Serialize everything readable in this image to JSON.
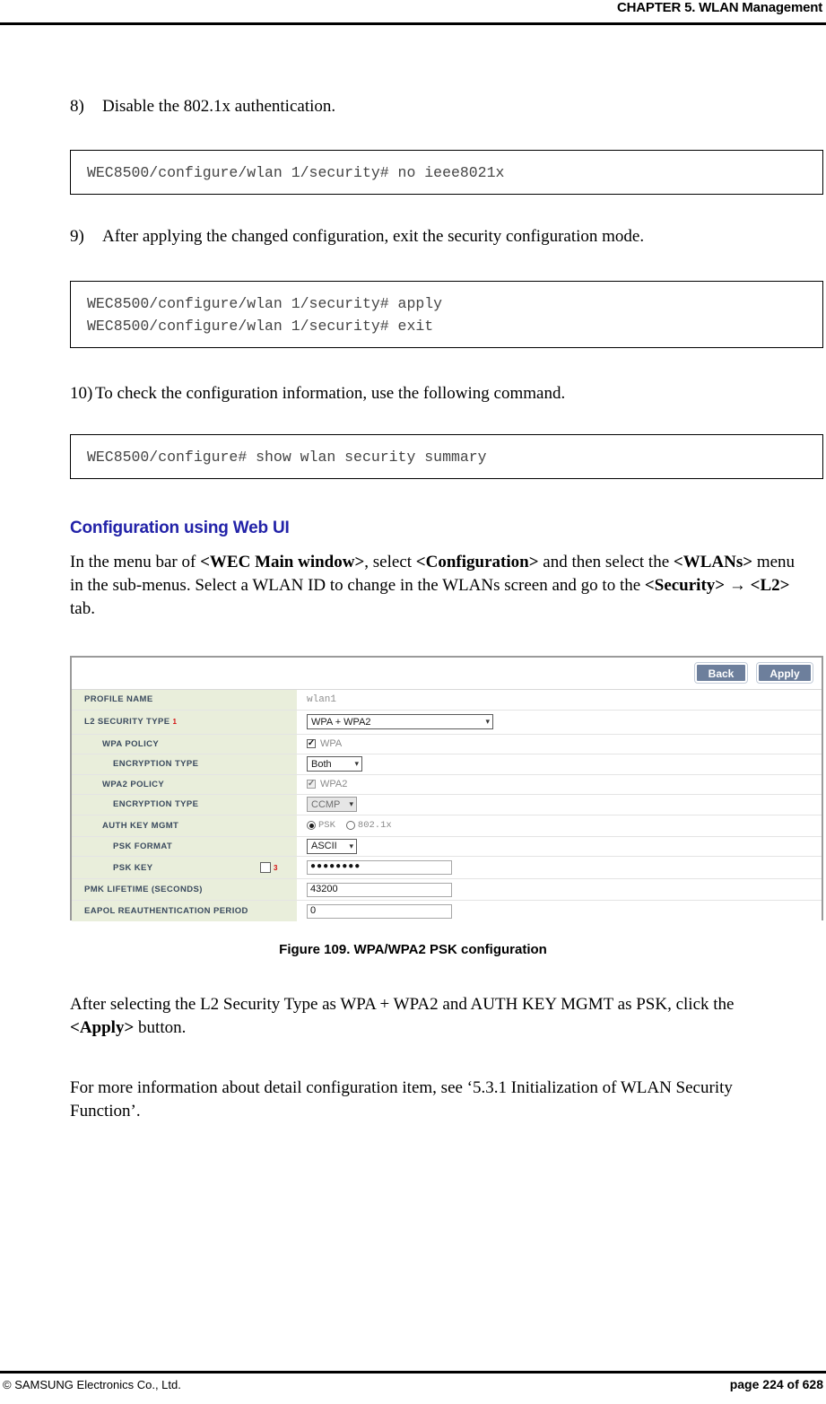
{
  "header": {
    "title": "CHAPTER 5. WLAN Management"
  },
  "footer": {
    "copyright": "© SAMSUNG Electronics Co., Ltd.",
    "page": "page 224 of 628"
  },
  "steps": {
    "step8": {
      "num": "8)",
      "text": "Disable the 802.1x authentication."
    },
    "step9": {
      "num": "9)",
      "text": "After applying the changed configuration, exit the security configuration mode."
    },
    "step10": {
      "num": "10)",
      "text": "To check the configuration information, use the following command."
    }
  },
  "code": {
    "block1_line1": "WEC8500/configure/wlan 1/security# no ieee8021x",
    "block2_line1": "WEC8500/configure/wlan 1/security# apply",
    "block2_line2": "WEC8500/configure/wlan 1/security# exit",
    "block3_line1": "WEC8500/configure# show wlan security summary"
  },
  "section": {
    "heading": "Configuration using Web UI",
    "intro_1": "In the menu bar of ",
    "intro_b1": "<WEC Main window>",
    "intro_2": ", select ",
    "intro_b2": "<Configuration>",
    "intro_3": " and then select the ",
    "intro_b3": "<WLANs>",
    "intro_4": " menu in the sub-menus. Select a WLAN ID to change in the WLANs screen and go to the ",
    "intro_b4": "<Security>",
    "intro_arrow": " → ",
    "intro_b5": "<L2>",
    "intro_5": " tab."
  },
  "figure": {
    "caption": "Figure 109. WPA/WPA2 PSK configuration",
    "toolbar": {
      "back_label": "Back",
      "apply_label": "Apply"
    },
    "rows": [
      {
        "label": "PROFILE NAME",
        "value": "wlan1"
      },
      {
        "label": "L2 SECURITY TYPE",
        "superscript": "1",
        "value": "WPA + WPA2"
      },
      {
        "label": "WPA POLICY",
        "checkbox_label": "WPA",
        "checked": true
      },
      {
        "label": "ENCRYPTION TYPE",
        "value": "Both"
      },
      {
        "label": "WPA2 POLICY",
        "checkbox_label": "WPA2",
        "checked": true
      },
      {
        "label": "ENCRYPTION TYPE",
        "value": "CCMP"
      },
      {
        "label": "AUTH KEY MGMT",
        "option1": "PSK",
        "option2": "802.1x",
        "selected": "PSK"
      },
      {
        "label": "PSK FORMAT",
        "value": "ASCII"
      },
      {
        "label": "PSK KEY",
        "superscript": "3",
        "value": "●●●●●●●●"
      },
      {
        "label": "PMK LIFETIME (SECONDS)",
        "value": "43200"
      },
      {
        "label": "EAPOL REAUTHENTICATION PERIOD",
        "value": "0"
      }
    ]
  },
  "closing": {
    "para1_a": "After selecting the L2 Security Type as WPA + WPA2 and AUTH KEY MGMT as PSK, click the ",
    "para1_b": "<Apply>",
    "para1_c": " button.",
    "para2": "For more information about detail configuration item, see ‘5.3.1 Initialization of WLAN Security Function’."
  },
  "colors": {
    "heading": "#2222a8",
    "label_bg": "#e9eedb",
    "button_bg": "#6d7f9c",
    "superscript": "#d31010"
  }
}
